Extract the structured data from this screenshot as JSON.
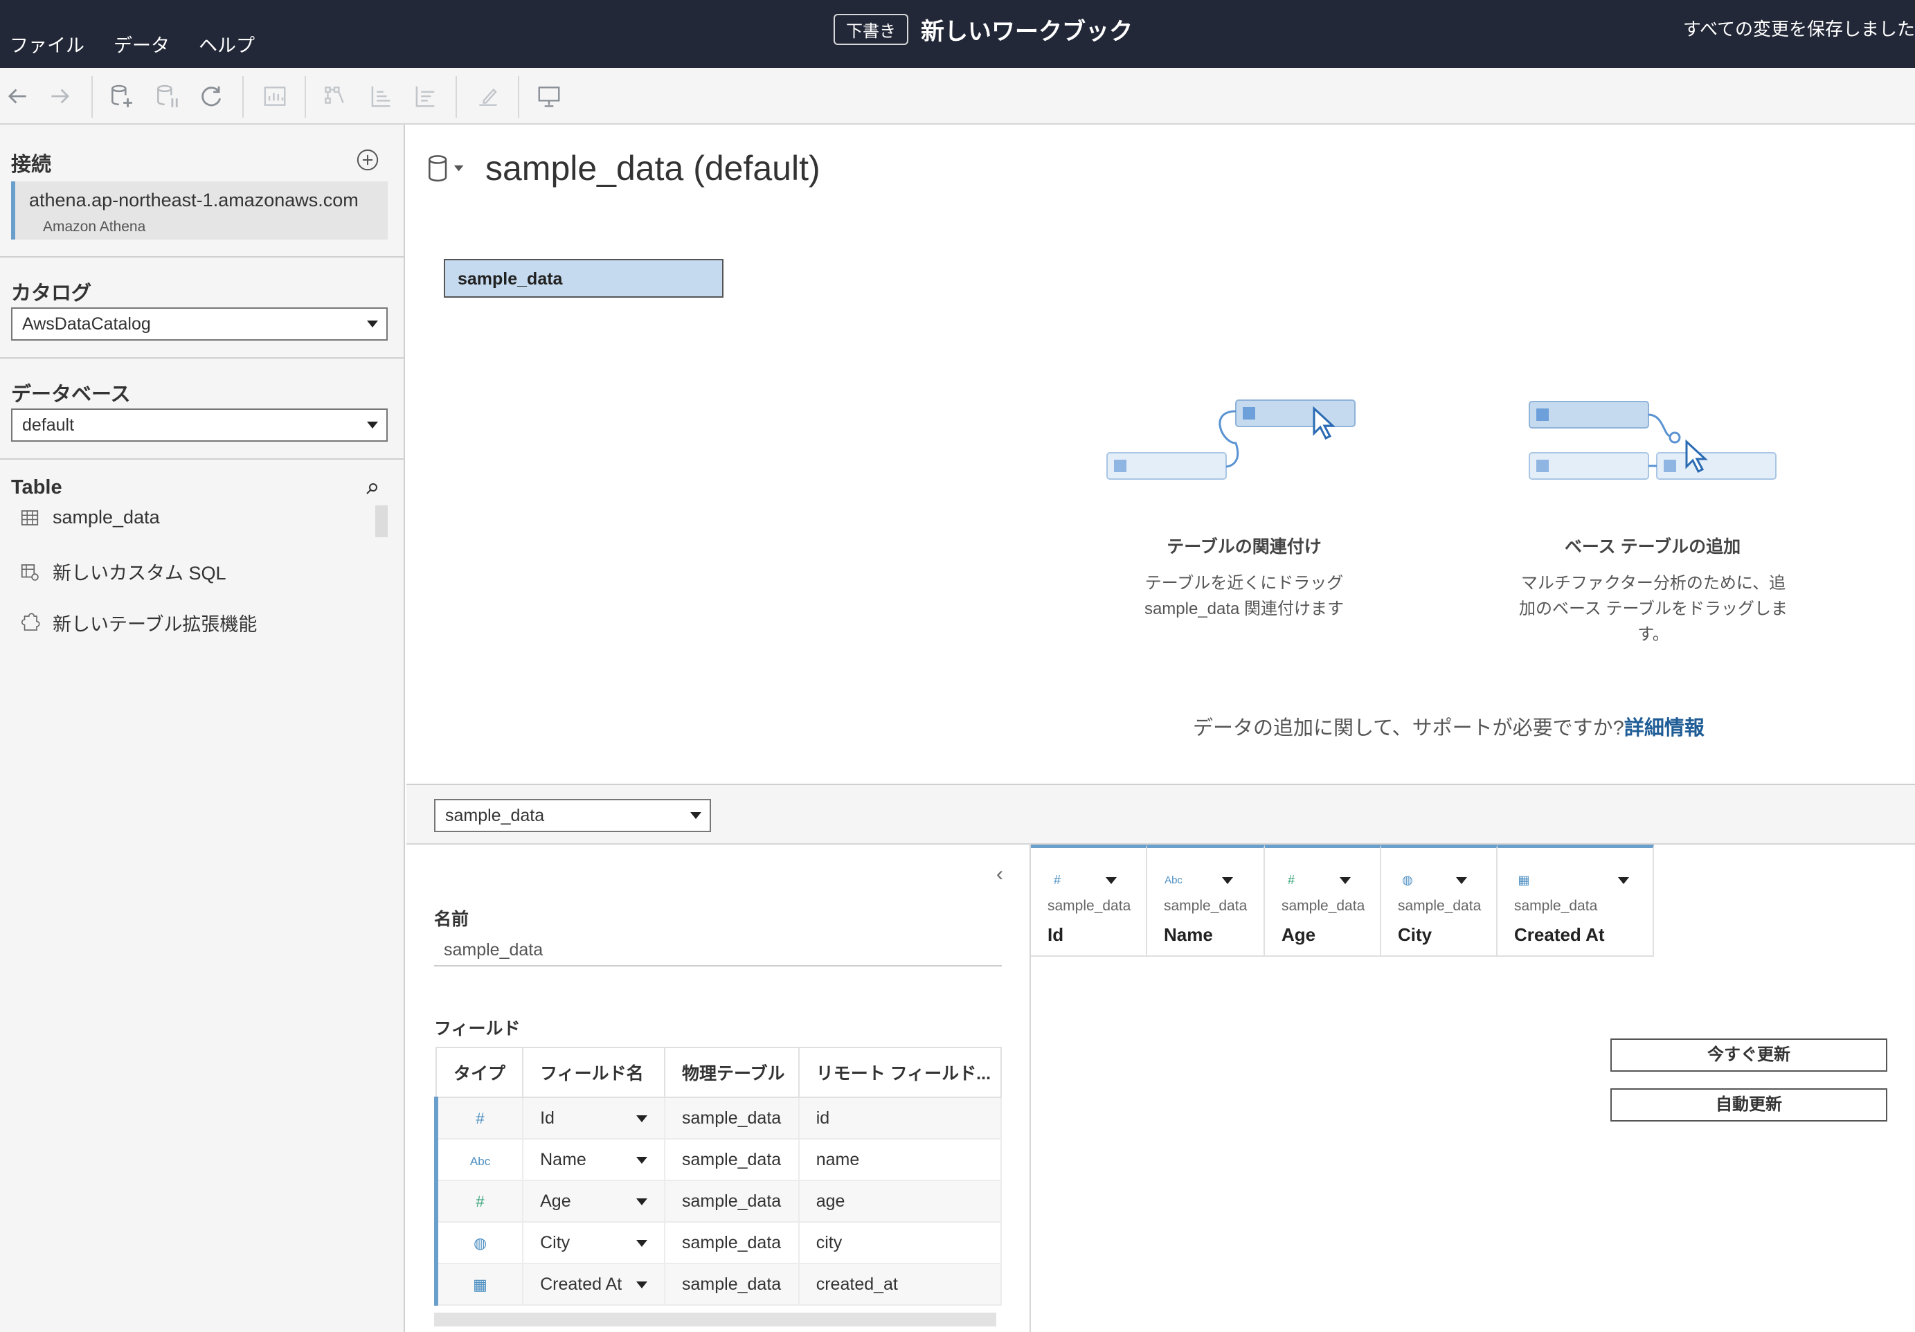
{
  "titlebar": {
    "menu": [
      "ファイル",
      "データ",
      "ヘルプ"
    ],
    "draft_badge": "下書き",
    "workbook_title": "新しいワークブック",
    "save_status": "すべての変更を保存しました"
  },
  "sidebar": {
    "connections_label": "接続",
    "connection": {
      "host": "athena.ap-northeast-1.amazonaws.com",
      "type": "Amazon Athena"
    },
    "catalog_label": "カタログ",
    "catalog_value": "AwsDataCatalog",
    "database_label": "データベース",
    "database_value": "default",
    "table_label": "Table",
    "items": [
      {
        "label": "sample_data",
        "icon": "table-icon"
      },
      {
        "label": "新しいカスタム SQL",
        "icon": "custom-sql-icon"
      },
      {
        "label": "新しいテーブル拡張機能",
        "icon": "extension-icon"
      }
    ]
  },
  "canvas": {
    "datasource_title": "sample_data (default)",
    "table_box": "sample_data",
    "hint1": {
      "title": "テーブルの関連付け",
      "line1": "テーブルを近くにドラッグ",
      "line2": "sample_data 関連付けます"
    },
    "hint2": {
      "title": "ベース テーブルの追加",
      "line1": "マルチファクター分析のために、追",
      "line2": "加のベース テーブルをドラッグしま",
      "line3": "す。"
    },
    "help_text": "データの追加に関して、サポートが必要ですか?",
    "help_link": "詳細情報"
  },
  "midbar": {
    "table_select": "sample_data"
  },
  "details": {
    "name_label": "名前",
    "name_value": "sample_data",
    "fields_label": "フィールド",
    "headers": [
      "タイプ",
      "フィールド名",
      "物理テーブル",
      "リモート フィールド..."
    ],
    "rows": [
      {
        "type_icon": "number-icon",
        "type_glyph": "#",
        "field": "Id",
        "table": "sample_data",
        "remote": "id",
        "color": "#4d8fc2"
      },
      {
        "type_icon": "string-icon",
        "type_glyph": "Abc",
        "field": "Name",
        "table": "sample_data",
        "remote": "name",
        "color": "#4d8fc2"
      },
      {
        "type_icon": "number-icon",
        "type_glyph": "#",
        "field": "Age",
        "table": "sample_data",
        "remote": "age",
        "color": "#3aa57a"
      },
      {
        "type_icon": "globe-icon",
        "type_glyph": "◍",
        "field": "City",
        "table": "sample_data",
        "remote": "city",
        "color": "#4d8fc2"
      },
      {
        "type_icon": "calendar-icon",
        "type_glyph": "▦",
        "field": "Created At",
        "table": "sample_data",
        "remote": "created_at",
        "color": "#4d8fc2"
      }
    ]
  },
  "grid": {
    "columns": [
      {
        "glyph": "#",
        "source": "sample_data",
        "name": "Id",
        "color": "#4d8fc2"
      },
      {
        "glyph": "Abc",
        "source": "sample_data",
        "name": "Name",
        "color": "#4d8fc2"
      },
      {
        "glyph": "#",
        "source": "sample_data",
        "name": "Age",
        "color": "#3aa57a"
      },
      {
        "glyph": "◍",
        "source": "sample_data",
        "name": "City",
        "color": "#4d8fc2"
      },
      {
        "glyph": "▦",
        "source": "sample_data",
        "name": "Created At",
        "color": "#4d8fc2"
      }
    ],
    "update_now": "今すぐ更新",
    "auto_update": "自動更新"
  }
}
